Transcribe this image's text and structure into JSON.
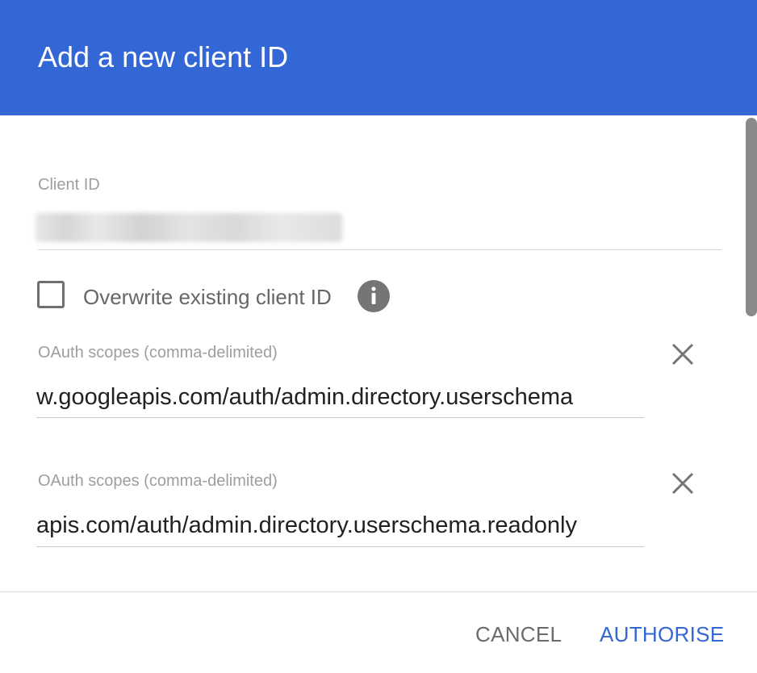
{
  "dialog": {
    "title": "Add a new client ID"
  },
  "client_id": {
    "label": "Client ID",
    "value_redacted": true
  },
  "overwrite": {
    "label": "Overwrite existing client ID",
    "checked": false,
    "info_icon": "info-icon"
  },
  "scopes": [
    {
      "label": "OAuth scopes (comma-delimited)",
      "value": "w.googleapis.com/auth/admin.directory.userschema",
      "remove_icon": "close-icon"
    },
    {
      "label": "OAuth scopes (comma-delimited)",
      "value": "apis.com/auth/admin.directory.userschema.readonly",
      "remove_icon": "close-icon"
    }
  ],
  "actions": {
    "cancel_label": "CANCEL",
    "authorise_label": "AUTHORISE"
  },
  "colors": {
    "header": "#3367d6",
    "primary_button": "#3367d6",
    "secondary_button": "#6b6b6b"
  }
}
